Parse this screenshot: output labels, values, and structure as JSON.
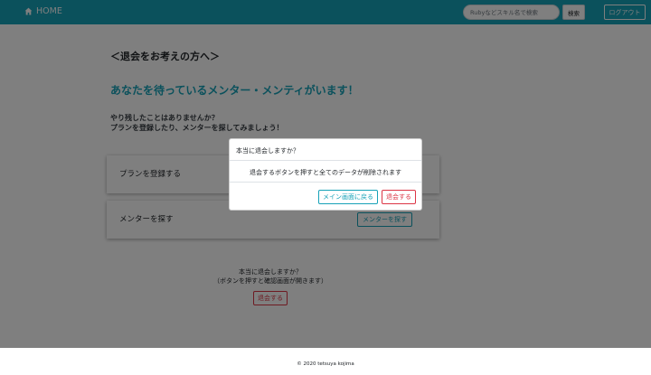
{
  "navbar": {
    "brand_color": "#17a2b8",
    "home_icon": "home-icon",
    "home_label": "HOME",
    "search_placeholder": "Rubyなどスキル名で検索",
    "search_button": "検索",
    "logout_label": "ログアウト"
  },
  "main": {
    "heading": "＜退会をお考えの方へ＞",
    "lead": "あなたを待っているメンター・メンティがいます！",
    "intro_line1": "やり残したことはありませんか？",
    "intro_line2": "プランを登録したり、メンターを探してみましょう！",
    "cards": [
      {
        "title": "プランを登録する"
      },
      {
        "title": "メンターを探す",
        "button": "メンターを探す"
      }
    ],
    "withdraw_question": "本当に退会しますか？",
    "withdraw_note": "（ボタンを押すと確認画面が開きます）",
    "withdraw_button": "退会する",
    "danger_color": "#dc3545"
  },
  "modal": {
    "title": "本当に退会しますか？",
    "message": "退会するボタンを押すと全てのデータが削除されます",
    "back_button": "メイン画面に戻る",
    "confirm_button": "退会する"
  },
  "footer": {
    "text": "© 2020 tetsuya kojima"
  }
}
